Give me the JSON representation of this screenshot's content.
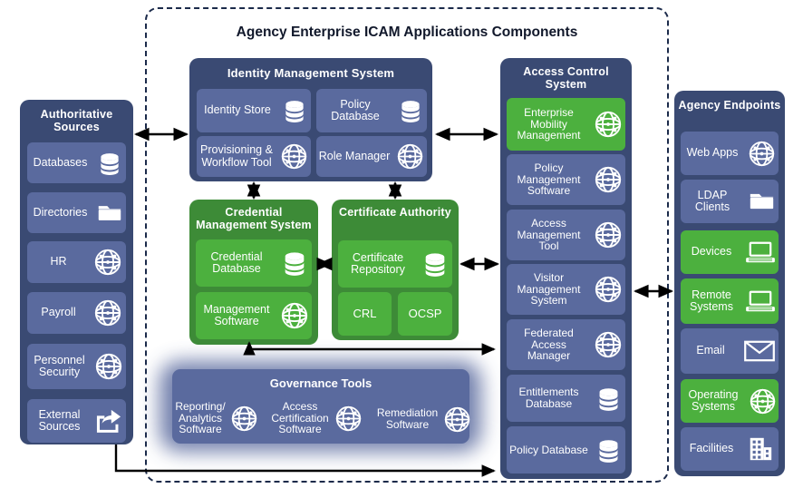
{
  "diagram": {
    "title": "Agency Enterprise ICAM Applications Components",
    "colors": {
      "panel_blue": "#3a4a73",
      "panel_green": "#3d8b37",
      "chip_blue": "#5a6a9e",
      "chip_green": "#4cb03e",
      "arrow": "#000000",
      "dashed_border": "#1b2a4a"
    }
  },
  "authoritative_sources": {
    "title": "Authoritative Sources",
    "items": [
      {
        "label": "Databases",
        "icon": "database-icon",
        "color": "blue"
      },
      {
        "label": "Directories",
        "icon": "folder-icon",
        "color": "blue"
      },
      {
        "label": "HR",
        "icon": "globe-icon",
        "color": "blue"
      },
      {
        "label": "Payroll",
        "icon": "globe-icon",
        "color": "blue"
      },
      {
        "label": "Personnel Security",
        "icon": "globe-icon",
        "color": "blue"
      },
      {
        "label": "External Sources",
        "icon": "share-export-icon",
        "color": "blue"
      }
    ]
  },
  "identity_management_system": {
    "title": "Identity Management System",
    "items": [
      {
        "label": "Identity Store",
        "icon": "database-icon",
        "color": "blue"
      },
      {
        "label": "Policy Database",
        "icon": "database-icon",
        "color": "blue"
      },
      {
        "label": "Provisioning & Workflow Tool",
        "icon": "globe-icon",
        "color": "blue"
      },
      {
        "label": "Role Manager",
        "icon": "globe-icon",
        "color": "blue"
      }
    ]
  },
  "credential_management_system": {
    "title": "Credential Management System",
    "items": [
      {
        "label": "Credential Database",
        "icon": "database-icon",
        "color": "green"
      },
      {
        "label": "Management Software",
        "icon": "globe-icon",
        "color": "green"
      }
    ]
  },
  "certificate_authority": {
    "title": "Certificate Authority",
    "items": [
      {
        "label": "Certificate Repository",
        "icon": "database-icon",
        "color": "green"
      },
      {
        "label": "CRL",
        "icon": "none",
        "color": "green"
      },
      {
        "label": "OCSP",
        "icon": "none",
        "color": "green"
      }
    ]
  },
  "access_control_system": {
    "title": "Access Control System",
    "items": [
      {
        "label": "Enterprise Mobility Management",
        "icon": "globe-icon",
        "color": "green"
      },
      {
        "label": "Policy Management Software",
        "icon": "globe-icon",
        "color": "blue"
      },
      {
        "label": "Access Management Tool",
        "icon": "globe-icon",
        "color": "blue"
      },
      {
        "label": "Visitor Management System",
        "icon": "globe-icon",
        "color": "blue"
      },
      {
        "label": "Federated Access Manager",
        "icon": "globe-icon",
        "color": "blue"
      },
      {
        "label": "Entitlements Database",
        "icon": "database-icon",
        "color": "blue"
      },
      {
        "label": "Policy Database",
        "icon": "database-icon",
        "color": "blue"
      }
    ]
  },
  "governance_tools": {
    "title": "Governance Tools",
    "items": [
      {
        "label": "Reporting/ Analytics Software",
        "icon": "globe-icon"
      },
      {
        "label": "Access Certification Software",
        "icon": "globe-icon"
      },
      {
        "label": "Remediation Software",
        "icon": "globe-icon"
      }
    ]
  },
  "agency_endpoints": {
    "title": "Agency Endpoints",
    "items": [
      {
        "label": "Web Apps",
        "icon": "globe-icon",
        "color": "blue"
      },
      {
        "label": "LDAP Clients",
        "icon": "folder-icon",
        "color": "blue"
      },
      {
        "label": "Devices",
        "icon": "laptop-icon",
        "color": "green"
      },
      {
        "label": "Remote Systems",
        "icon": "laptop-icon",
        "color": "green"
      },
      {
        "label": "Email",
        "icon": "envelope-icon",
        "color": "blue"
      },
      {
        "label": "Operating Systems",
        "icon": "globe-icon",
        "color": "green"
      },
      {
        "label": "Facilities",
        "icon": "building-icon",
        "color": "blue"
      }
    ]
  }
}
